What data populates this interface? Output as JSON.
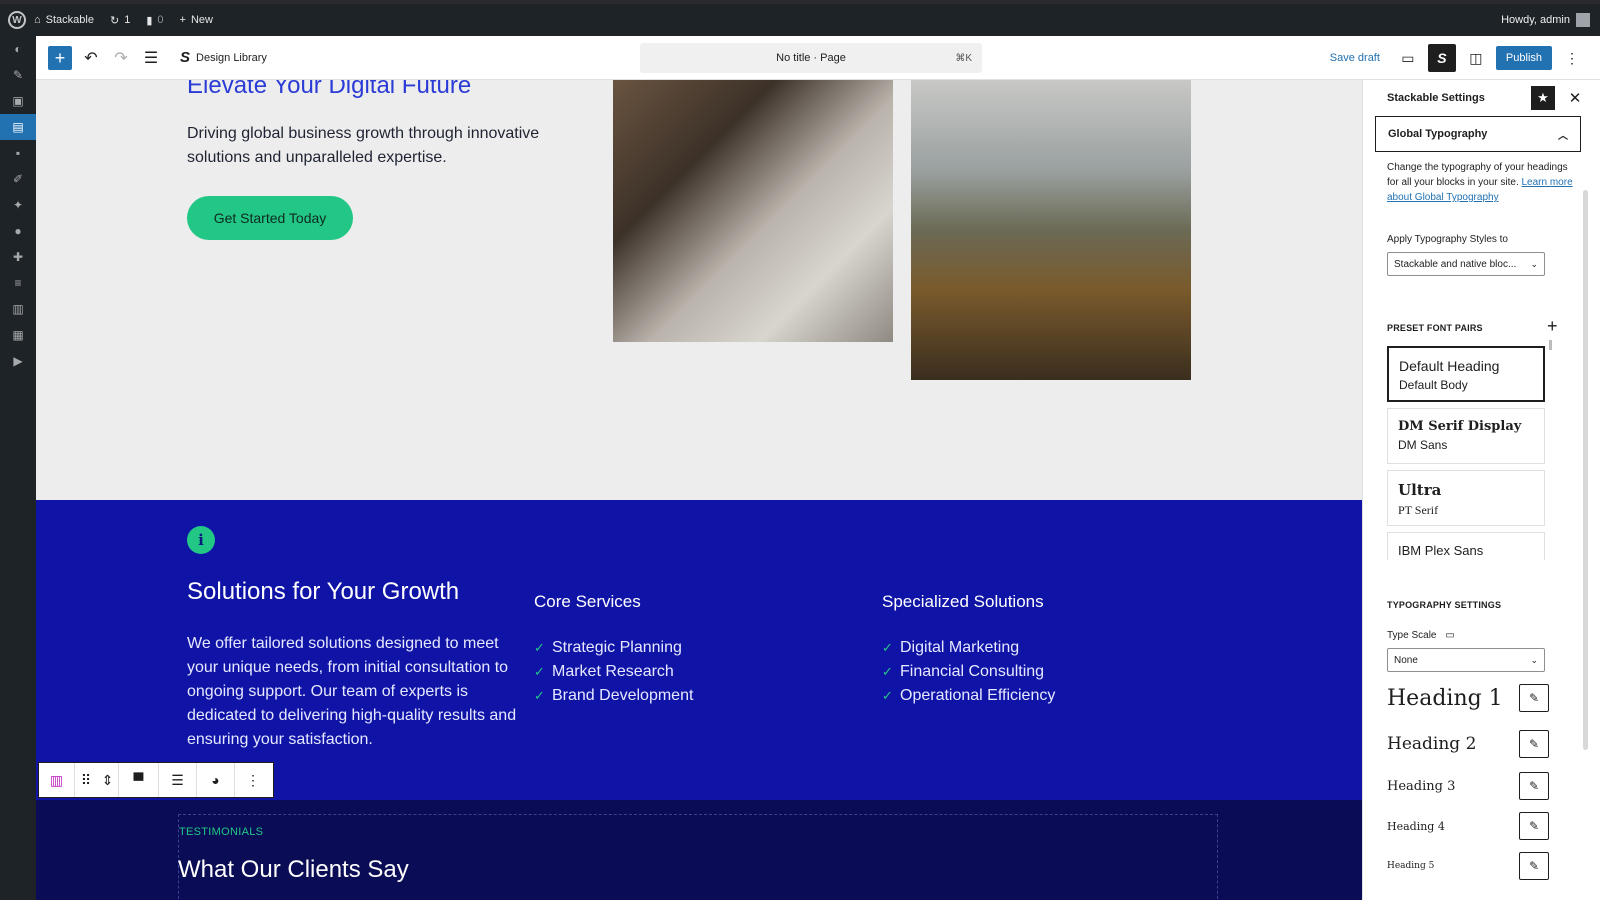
{
  "admin_bar": {
    "site_name": "Stackable",
    "updates_count": "1",
    "comments_count": "0",
    "new_label": "New",
    "greeting": "Howdy, admin"
  },
  "toolbar": {
    "design_library": "Design Library",
    "doc_title": "No title · Page",
    "shortcut": "⌘K",
    "save_draft": "Save draft",
    "publish": "Publish"
  },
  "hero": {
    "title": "Elevate Your Digital Future",
    "description": "Driving global business growth through innovative solutions and unparalleled expertise.",
    "cta": "Get Started Today"
  },
  "solutions": {
    "icon": "i",
    "title": "Solutions for Your Growth",
    "description": "We offer tailored solutions designed to meet your unique needs, from initial consultation to ongoing support. Our team of experts is dedicated to delivering high-quality results and ensuring your satisfaction.",
    "core": {
      "title": "Core Services",
      "items": [
        "Strategic Planning",
        "Market Research",
        "Brand Development"
      ]
    },
    "specialized": {
      "title": "Specialized Solutions",
      "items": [
        "Digital Marketing",
        "Financial Consulting",
        "Operational Efficiency"
      ]
    }
  },
  "testimonials": {
    "label": "TESTIMONIALS",
    "title": "What Our Clients Say"
  },
  "sidebar": {
    "title": "Stackable Settings",
    "panel_title": "Global Typography",
    "help_text": "Change the typography of your headings for all your blocks in your site.",
    "help_link": "Learn more about Global Typography",
    "apply_label": "Apply Typography Styles to",
    "apply_value": "Stackable and native bloc...",
    "preset_label": "PRESET FONT PAIRS",
    "pairs": [
      {
        "heading": "Default Heading",
        "body": "Default Body"
      },
      {
        "heading": "DM Serif Display",
        "body": "DM Sans"
      },
      {
        "heading": "Ultra",
        "body": "PT Serif"
      },
      {
        "heading": "IBM Plex Sans",
        "body": ""
      }
    ],
    "typography_label": "TYPOGRAPHY SETTINGS",
    "type_scale_label": "Type Scale",
    "type_scale_value": "None",
    "headings": [
      "Heading 1",
      "Heading 2",
      "Heading 3",
      "Heading 4",
      "Heading 5"
    ]
  },
  "colors": {
    "accent": "#2271b1",
    "brand_blue": "#1014a6",
    "brand_green": "#22c786",
    "dark_navy": "#0a0d55"
  }
}
